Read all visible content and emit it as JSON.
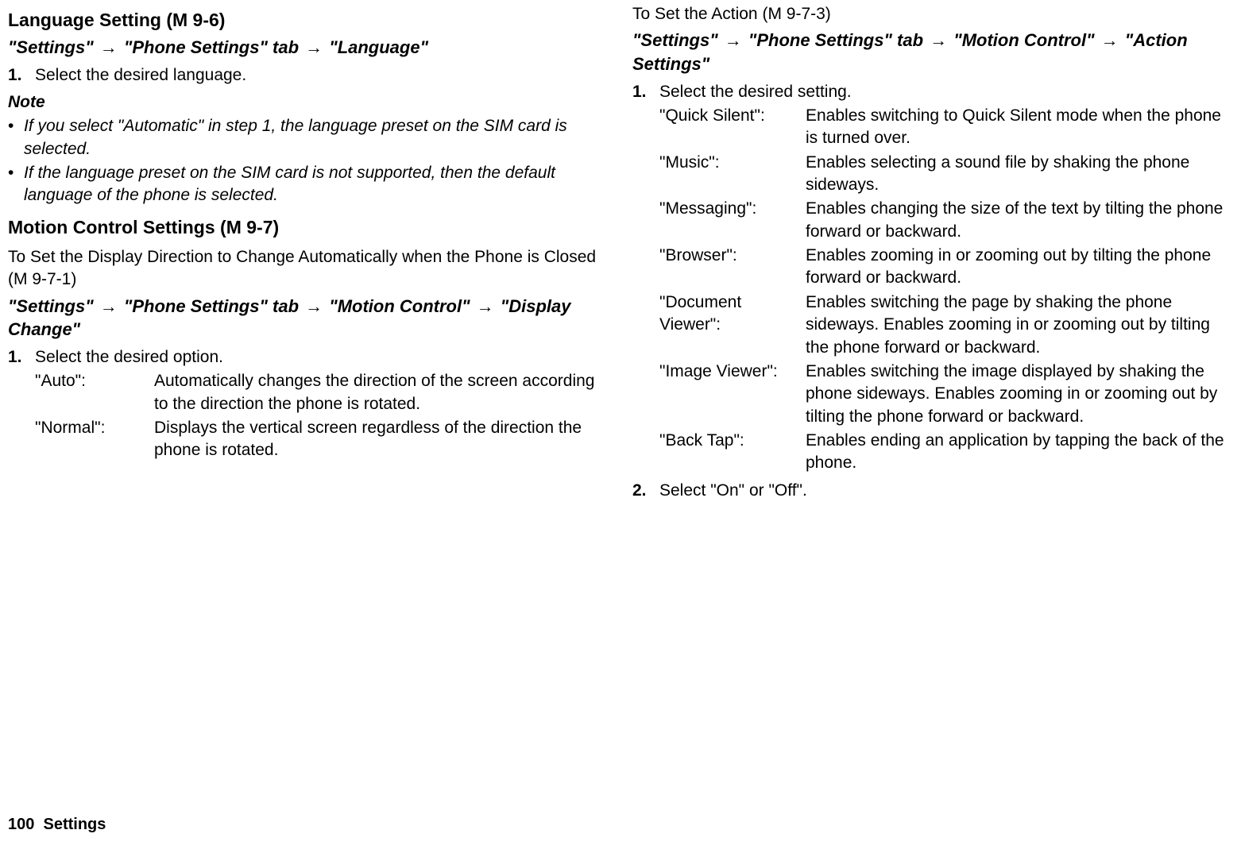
{
  "left": {
    "heading1": "Language Setting",
    "code1": "(M 9-6)",
    "path1_a": "\"Settings\"",
    "path1_b": "\"Phone Settings\" tab",
    "path1_c": "\"Language\"",
    "step1_num": "1.",
    "step1_text": "Select the desired language.",
    "note_label": "Note",
    "note_b1": "If you select \"Automatic\" in step 1, the language preset on the SIM card is selected.",
    "note_b2": "If the language preset on the SIM card is not supported, then the default language of the phone is selected.",
    "heading2": "Motion Control Settings",
    "code2": "(M 9-7)",
    "sub2": "To Set the Display Direction to Change Automatically when the Phone is Closed",
    "sub2_code": "(M 9-7-1)",
    "path2_a": "\"Settings\"",
    "path2_b": "\"Phone Settings\" tab",
    "path2_c": "\"Motion Control\"",
    "path2_d": "\"Display Change\"",
    "step2_num": "1.",
    "step2_text": "Select the desired option.",
    "opt1_term": "\"Auto\":",
    "opt1_desc": "Automatically changes the direction of the screen according to the direction the phone is rotated.",
    "opt2_term": "\"Normal\":",
    "opt2_desc": "Displays the vertical screen regardless of the direction the phone is rotated."
  },
  "right": {
    "sub1": "To Set the Action",
    "sub1_code": "(M 9-7-3)",
    "path_a": "\"Settings\"",
    "path_b": "\"Phone Settings\" tab",
    "path_c": "\"Motion Control\"",
    "path_d": "\"Action Settings\"",
    "step1_num": "1.",
    "step1_text": "Select the desired setting.",
    "opts": [
      {
        "term": "\"Quick Silent\":",
        "desc": "Enables switching to Quick Silent mode when the phone is turned over."
      },
      {
        "term": "\"Music\":",
        "desc": "Enables selecting a sound file by shaking the phone sideways."
      },
      {
        "term": "\"Messaging\":",
        "desc": "Enables changing the size of the text by tilting the phone forward or backward."
      },
      {
        "term": "\"Browser\":",
        "desc": "Enables zooming in or zooming out by tilting the phone forward or backward."
      },
      {
        "term": "\"Document Viewer\":",
        "desc": "Enables switching the page by shaking the phone sideways. Enables zooming in or zooming out by tilting the phone forward or backward."
      },
      {
        "term": "\"Image Viewer\":",
        "desc": "Enables switching the image displayed by shaking the phone sideways. Enables zooming in or zooming out by tilting the phone forward or backward."
      },
      {
        "term": "\"Back Tap\":",
        "desc": "Enables ending an application by tapping the back of the phone."
      }
    ],
    "step2_num": "2.",
    "step2_text": "Select \"On\" or \"Off\"."
  },
  "footer": {
    "page": "100",
    "section": "Settings"
  },
  "glyphs": {
    "arrow": "→",
    "bullet": "•"
  }
}
